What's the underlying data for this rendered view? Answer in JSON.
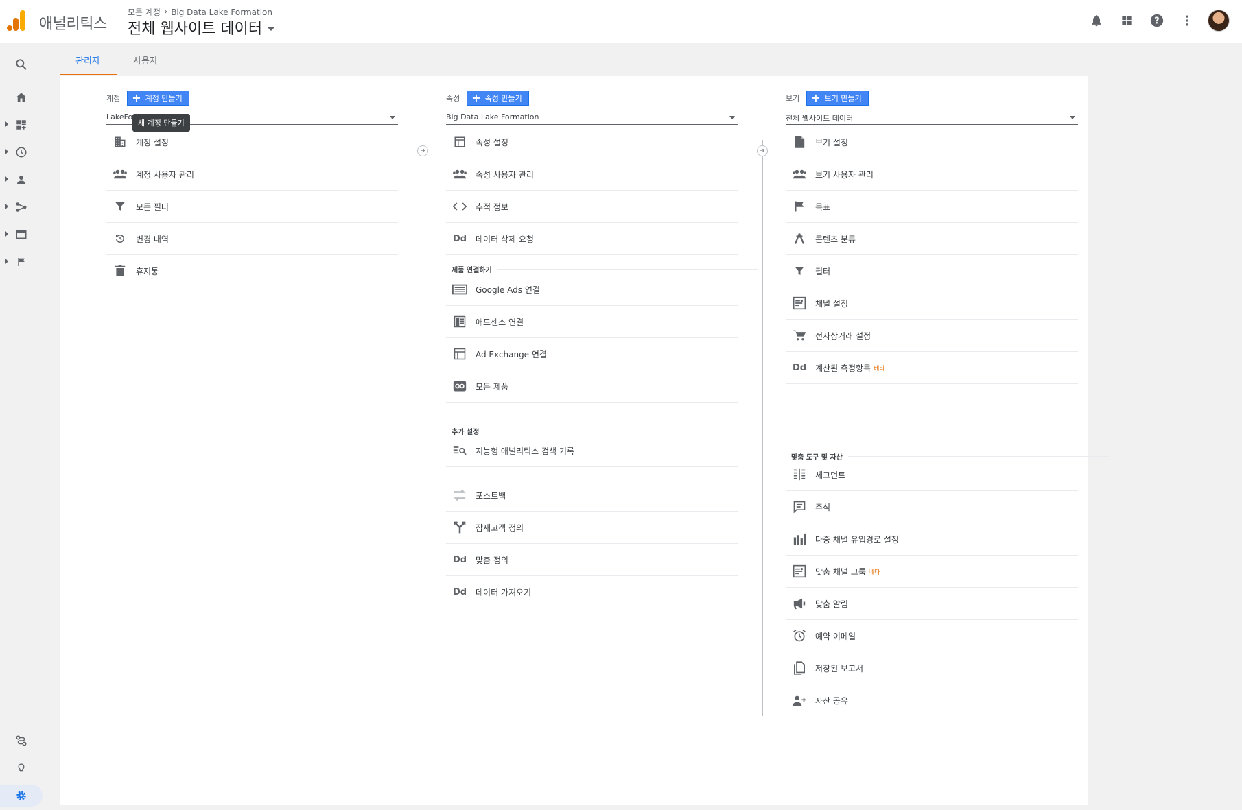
{
  "header": {
    "app_name": "애널리틱스",
    "breadcrumb_root": "모든 계정",
    "breadcrumb_sep": "›",
    "breadcrumb_property": "Big Data Lake Formation",
    "view_title": "전체 웹사이트 데이터"
  },
  "tabs": [
    {
      "label": "관리자",
      "active": true
    },
    {
      "label": "사용자",
      "active": false
    }
  ],
  "account": {
    "label": "계정",
    "create_label": "계정 만들기",
    "selected": "LakeFormation",
    "tooltip": "새 계정 만들기",
    "items": [
      {
        "label": "계정 설정",
        "icon": "building-icon"
      },
      {
        "label": "계정 사용자 관리",
        "icon": "people-icon"
      },
      {
        "label": "모든 필터",
        "icon": "filter-icon"
      },
      {
        "label": "변경 내역",
        "icon": "history-icon"
      },
      {
        "label": "휴지통",
        "icon": "trash-icon"
      }
    ]
  },
  "property": {
    "label": "속성",
    "create_label": "속성 만들기",
    "selected": "Big Data Lake Formation",
    "items": [
      {
        "label": "속성 설정",
        "icon": "property-settings-icon"
      },
      {
        "label": "속성 사용자 관리",
        "icon": "people-icon"
      },
      {
        "label": "추적 정보",
        "icon": "code-icon"
      },
      {
        "label": "데이터 삭제 요청",
        "icon": "dd-icon"
      }
    ],
    "product_linking_header": "제품 연결하기",
    "product_links": [
      {
        "label": "Google Ads 연결",
        "icon": "ads-icon"
      },
      {
        "label": "애드센스 연결",
        "icon": "adsense-icon"
      },
      {
        "label": "Ad Exchange 연결",
        "icon": "adexchange-icon"
      },
      {
        "label": "모든 제품",
        "icon": "all-products-icon"
      }
    ],
    "additional_header": "추가 설정",
    "additional": [
      {
        "label": "지능형 애널리틱스 검색 기록",
        "icon": "search-history-icon"
      },
      {
        "label": "포스트백",
        "icon": "postback-icon"
      },
      {
        "label": "잠재고객 정의",
        "icon": "audience-icon"
      },
      {
        "label": "맞춤 정의",
        "icon": "dd-icon"
      },
      {
        "label": "데이터 가져오기",
        "icon": "dd-icon"
      }
    ]
  },
  "view": {
    "label": "보기",
    "create_label": "보기 만들기",
    "selected": "전체 웹사이트 데이터",
    "items": [
      {
        "label": "보기 설정",
        "icon": "document-icon"
      },
      {
        "label": "보기 사용자 관리",
        "icon": "people-icon"
      },
      {
        "label": "목표",
        "icon": "flag-icon"
      },
      {
        "label": "콘텐츠 분류",
        "icon": "content-grouping-icon"
      },
      {
        "label": "필터",
        "icon": "filter-icon"
      },
      {
        "label": "채널 설정",
        "icon": "channel-settings-icon"
      },
      {
        "label": "전자상거래 설정",
        "icon": "cart-icon"
      },
      {
        "label": "계산된 측정항목",
        "icon": "dd-icon",
        "beta": "베타"
      }
    ],
    "tools_header": "맞춤 도구 및 자산",
    "tools": [
      {
        "label": "세그먼트",
        "icon": "segments-icon"
      },
      {
        "label": "주석",
        "icon": "annotations-icon"
      },
      {
        "label": "다중 채널 유입경로 설정",
        "icon": "bar-chart-icon"
      },
      {
        "label": "맞춤 채널 그룹",
        "icon": "channel-settings-icon",
        "beta": "베타"
      },
      {
        "label": "맞춤 알림",
        "icon": "megaphone-icon"
      },
      {
        "label": "예약 이메일",
        "icon": "alarm-icon"
      },
      {
        "label": "저장된 보고서",
        "icon": "saved-report-icon"
      },
      {
        "label": "자산 공유",
        "icon": "person-add-icon"
      }
    ]
  },
  "colors": {
    "accent_blue": "#4285f4",
    "tab_active": "#1a73e8",
    "underline_orange": "#e8710a",
    "logo_orange": "#f9ab00",
    "logo_dark_orange": "#e37400"
  }
}
